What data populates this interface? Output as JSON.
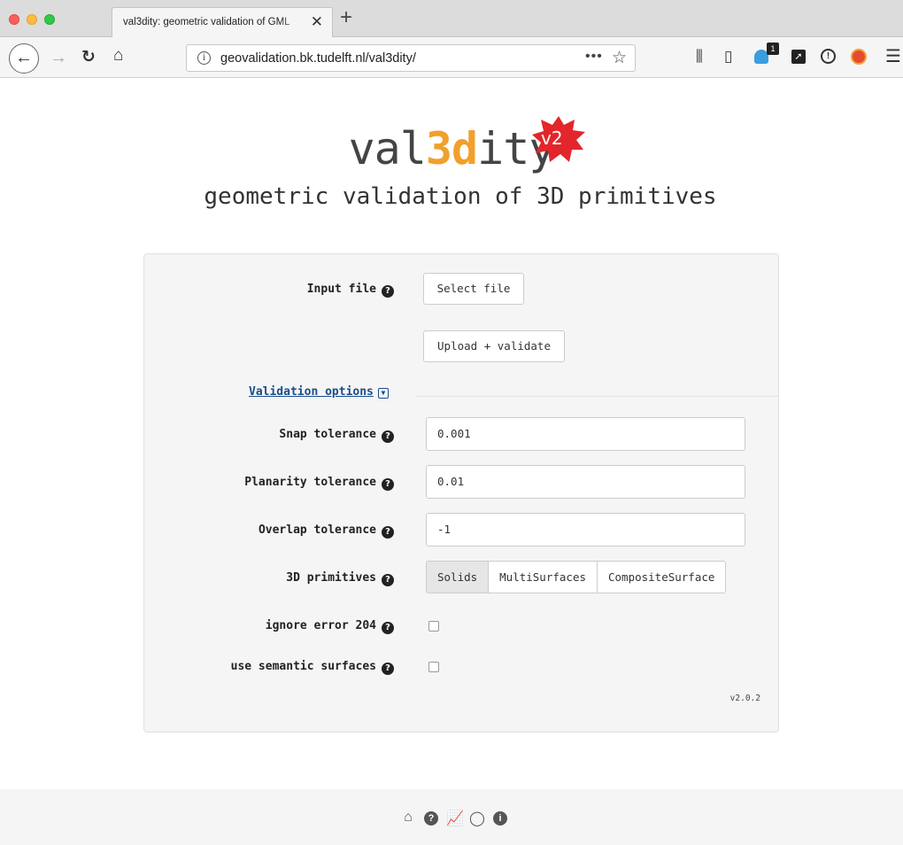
{
  "browser": {
    "tab_title": "val3dity: geometric validation of GML",
    "tab_close": "✕",
    "new_tab": "+",
    "url": "geovalidation.bk.tudelft.nl/val3dity/",
    "url_more": "•••",
    "ext_badge_count": "1"
  },
  "header": {
    "logo_pre": "val",
    "logo_accent": "3d",
    "logo_post": "ity",
    "version_badge": "v2",
    "tagline": "geometric validation of 3D primitives"
  },
  "form": {
    "input_file_label": "Input file",
    "select_file_button": "Select file",
    "upload_button": "Upload + validate",
    "validation_options_link": "Validation options",
    "snap_tolerance_label": "Snap tolerance",
    "snap_tolerance_value": "0.001",
    "planarity_tolerance_label": "Planarity tolerance",
    "planarity_tolerance_value": "0.01",
    "overlap_tolerance_label": "Overlap tolerance",
    "overlap_tolerance_value": "-1",
    "primitives_label": "3D primitives",
    "primitives_options": [
      "Solids",
      "MultiSurfaces",
      "CompositeSurface"
    ],
    "primitives_selected": "Solids",
    "ignore_error_label": "ignore error 204",
    "ignore_error_checked": false,
    "semantic_surfaces_label": "use semantic surfaces",
    "semantic_surfaces_checked": false,
    "version": "v2.0.2"
  },
  "footer": {
    "icons": [
      "home-icon",
      "help-icon",
      "stats-icon",
      "github-icon",
      "info-icon"
    ]
  },
  "colors": {
    "accent": "#f1a02b",
    "badge_red": "#e3262b",
    "link": "#1a4d8a"
  }
}
